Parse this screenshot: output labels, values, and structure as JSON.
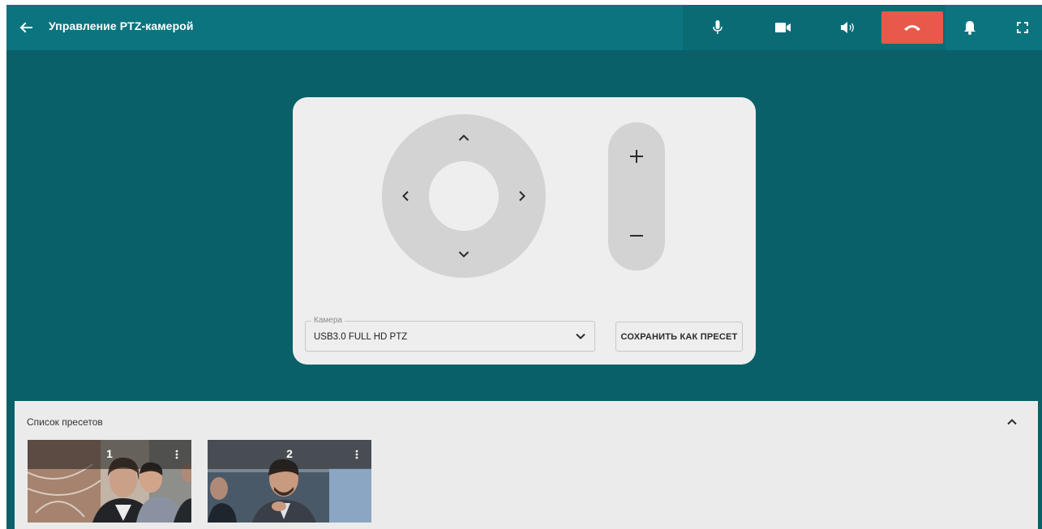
{
  "header": {
    "title": "Управление PTZ-камерой",
    "icons": [
      "back-arrow-icon",
      "microphone-icon",
      "video-camera-icon",
      "speaker-icon",
      "hang-up-icon",
      "bell-icon",
      "fullscreen-icon"
    ],
    "hangup_color": "#e8594a"
  },
  "ptz": {
    "dpad_icons": [
      "chevron-up-icon",
      "chevron-left-icon",
      "chevron-right-icon",
      "chevron-down-icon"
    ],
    "zoom_icons": [
      "plus-icon",
      "minus-icon"
    ],
    "camera_label": "Камера",
    "camera_value": "USB3.0 FULL HD PTZ",
    "save_preset_label": "СОХРАНИТЬ КАК ПРЕСЕТ"
  },
  "presets": {
    "title": "Список пресетов",
    "items": [
      {
        "number": "1"
      },
      {
        "number": "2"
      }
    ]
  },
  "colors": {
    "header_bg": "#0c747f",
    "page_bg": "#0a6069",
    "panel_bg": "#eeeeee",
    "control_bg": "#d3d3d3"
  }
}
